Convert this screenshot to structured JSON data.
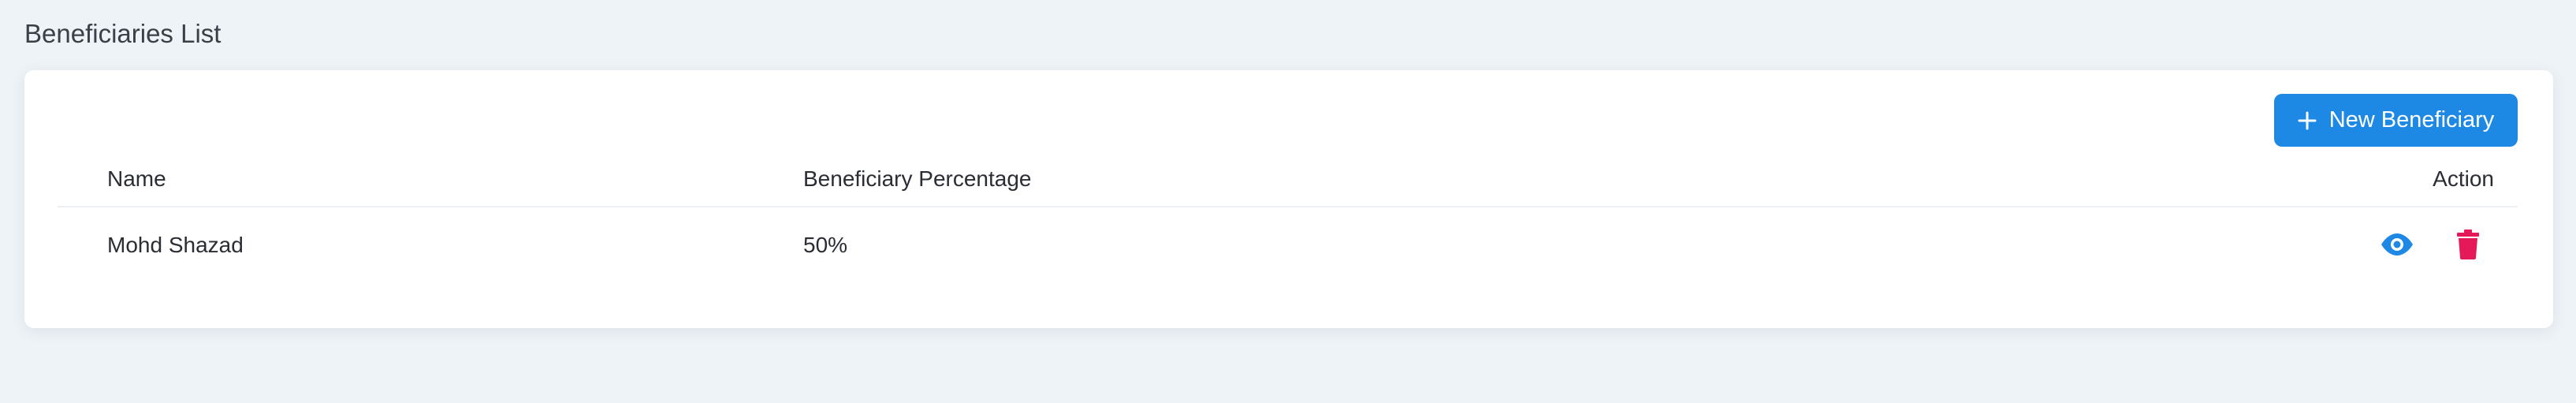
{
  "page": {
    "title": "Beneficiaries List"
  },
  "toolbar": {
    "new_button_label": "New Beneficiary",
    "new_button_icon": "plus-icon"
  },
  "table": {
    "columns": [
      "Name",
      "Beneficiary Percentage",
      "Action"
    ],
    "rows": [
      {
        "name": "Mohd Shazad",
        "percentage": "50%",
        "actions": [
          "eye-icon",
          "trash-icon"
        ]
      }
    ]
  },
  "colors": {
    "background": "#eef3f7",
    "primary": "#1e88e5",
    "view_icon": "#1e88e5",
    "delete_icon": "#e5195a"
  }
}
